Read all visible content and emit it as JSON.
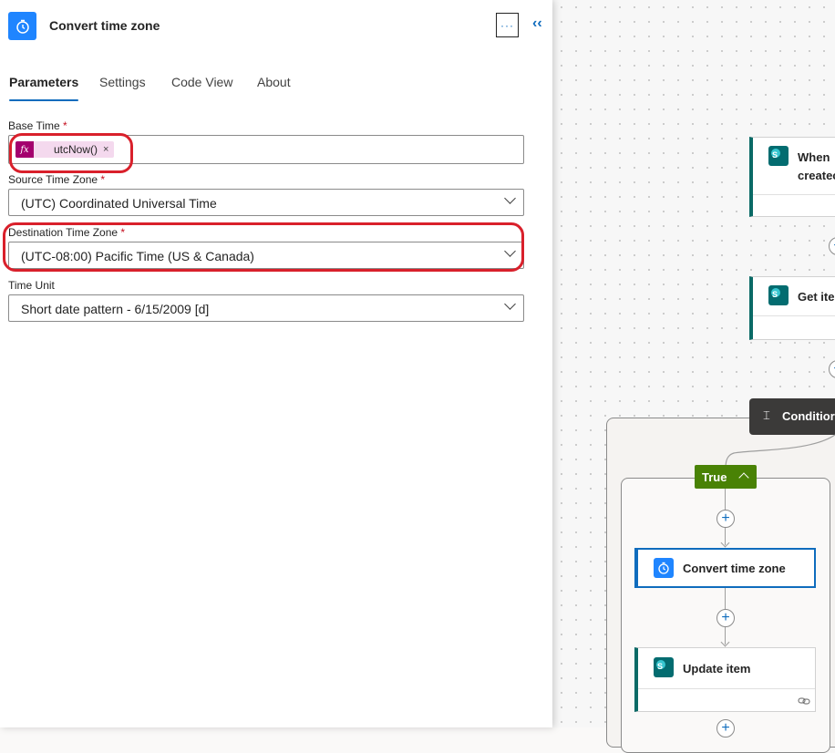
{
  "panel": {
    "title": "Convert time zone",
    "more_label": "···",
    "collapse_label": "‹‹",
    "icon": "alarm-clock-icon",
    "icon_color": "#1f85ff",
    "tabs": [
      {
        "label": "Parameters",
        "active": true
      },
      {
        "label": "Settings",
        "active": false
      },
      {
        "label": "Code View",
        "active": false
      },
      {
        "label": "About",
        "active": false
      }
    ],
    "fields": {
      "base_time": {
        "label": "Base Time",
        "required": "*",
        "token_value": "utcNow()",
        "token_remove": "×",
        "token_icon": "fx"
      },
      "source_tz": {
        "label": "Source Time Zone",
        "required": "*",
        "value": "(UTC) Coordinated Universal Time"
      },
      "dest_tz": {
        "label": "Destination Time Zone",
        "required": "*",
        "value": "(UTC-08:00) Pacific Time (US & Canada)"
      },
      "time_unit": {
        "label": "Time Unit",
        "value": "Short date pattern - 6/15/2009 [d]"
      }
    }
  },
  "flow": {
    "trigger_title_line1": "When",
    "trigger_title_line2": "createc",
    "get_item_title": "Get ite",
    "condition_title": "Conditior",
    "true_branch_label": "True",
    "convert_card_title": "Convert time zone",
    "update_card_title": "Update item",
    "add_label": "+"
  },
  "colors": {
    "accent": "#0f6cbd",
    "highlight": "#d9202b",
    "true_branch": "#498205",
    "condition_header": "#3b3a39",
    "sharepoint": "#036c70"
  }
}
